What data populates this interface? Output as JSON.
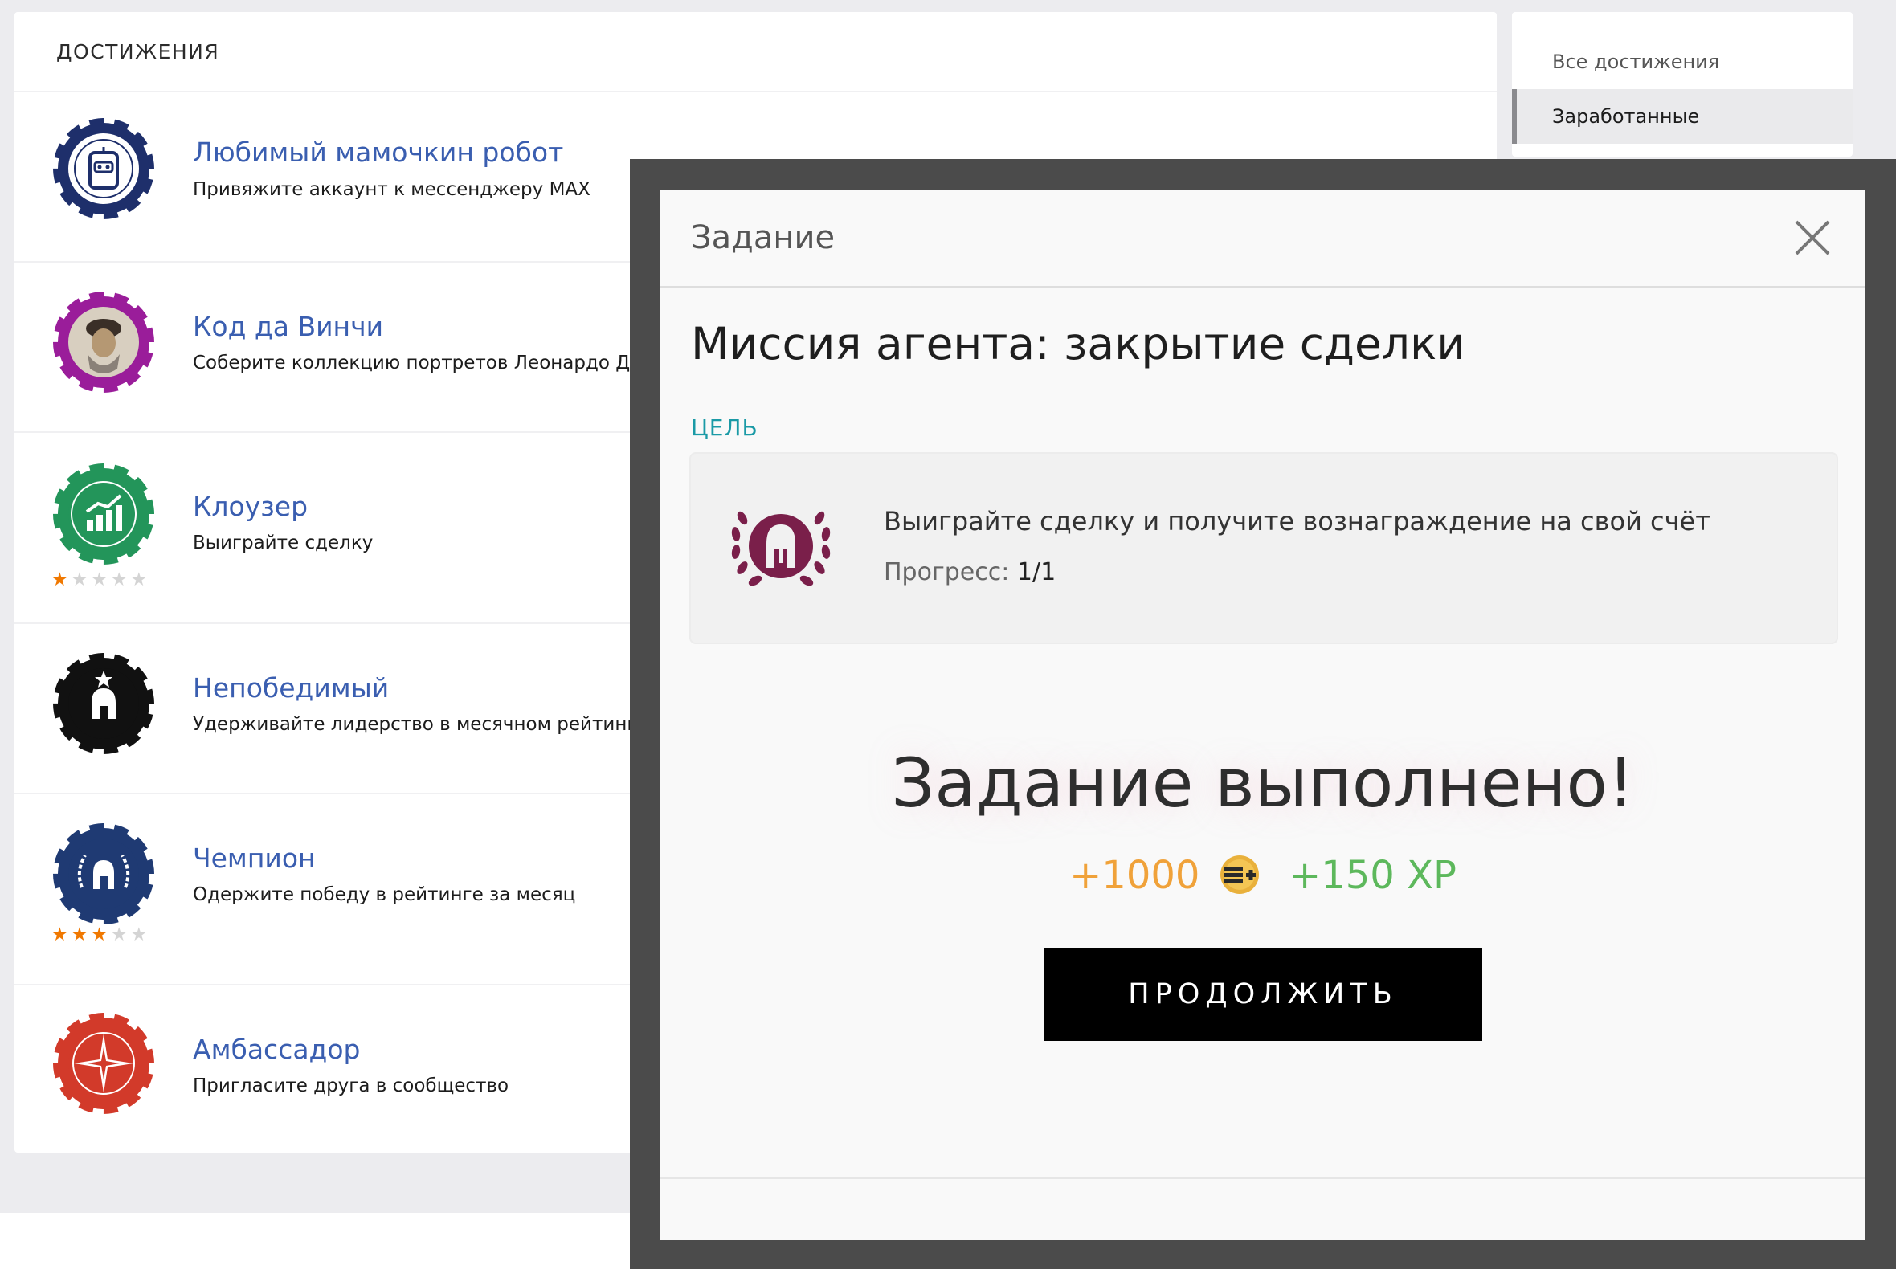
{
  "achievements": {
    "header": "ДОСТИЖЕНИЯ",
    "items": [
      {
        "title": "Любимый мамочкин робот",
        "desc": "Привяжите аккаунт к мессенджеру MAX"
      },
      {
        "title": "Код да Винчи",
        "desc": "Соберите коллекцию портретов Леонардо Да В"
      },
      {
        "title": "Клоузер",
        "desc": "Выиграйте сделку",
        "stars_filled": 1,
        "stars_total": 5
      },
      {
        "title": "Непобедимый",
        "desc": "Удерживайте лидерство в месячном рейтинге в"
      },
      {
        "title": "Чемпион",
        "desc": "Одержите победу в рейтинге за месяц",
        "stars_filled": 3,
        "stars_total": 5
      },
      {
        "title": "Амбассадор",
        "desc": "Пригласите друга в сообщество"
      }
    ]
  },
  "filter": {
    "items": [
      "Все достижения",
      "Заработанные"
    ],
    "active": "Заработанные"
  },
  "modal": {
    "title": "Задание",
    "mission_title": "Миссия агента: закрытие сделки",
    "goal_label": "ЦЕЛЬ",
    "goal_text": "Выиграйте сделку и получите вознаграждение на свой счёт",
    "progress_label": "Прогресс:",
    "progress_value": "1/1",
    "done_text": "Задание выполнено!",
    "reward_coins": "+1000",
    "reward_xp": "+150 XP",
    "continue_label": "ПРОДОЛЖИТЬ"
  },
  "icons": {
    "robot": "robot-chip-icon",
    "davinci": "davinci-portrait-chip-icon",
    "closer": "growth-chart-chip-icon",
    "invincible": "helmet-star-chip-icon",
    "champion": "helmet-laurel-chip-icon",
    "ambassador": "compass-star-chip-icon",
    "goal": "laurel-helmet-icon",
    "coin": "coin-icon",
    "close": "close-icon"
  },
  "colors": {
    "link": "#3a5eb0",
    "goal_label": "#1a9aa6",
    "coins": "#f0a23a",
    "xp": "#5db85c",
    "star_on": "#f07800",
    "goal_icon": "#7a1f4a"
  }
}
